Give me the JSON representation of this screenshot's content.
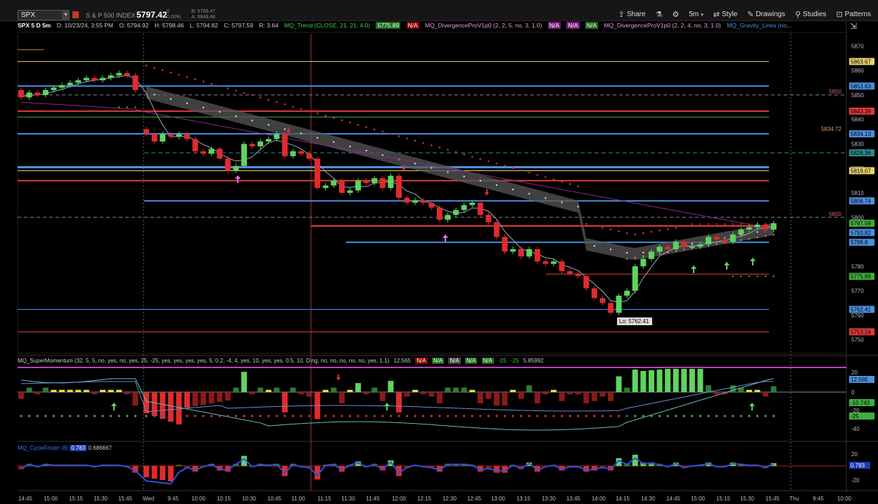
{
  "toolbar": {
    "symbol": "SPX",
    "description": "S & P 500 INDEX",
    "price": "5797.42",
    "change_line1": "0",
    "change_line2": "0.00%",
    "bid": "B: 5768.47",
    "ask": "A: 5848.48",
    "buttons": [
      {
        "icon": "share-icon",
        "label": "Share"
      },
      {
        "icon": "flask-icon",
        "label": ""
      },
      {
        "icon": "gear-icon",
        "label": ""
      },
      {
        "icon": "",
        "label": "5m"
      },
      {
        "icon": "style-icon",
        "label": "Style"
      },
      {
        "icon": "pencil-icon",
        "label": "Drawings"
      },
      {
        "icon": "studies-icon",
        "label": "Studies"
      },
      {
        "icon": "patterns-icon",
        "label": "Patterns"
      }
    ]
  },
  "info": {
    "symbol": "SPX 5 D 5m",
    "date": "D: 10/23/24, 3:55 PM",
    "open": "O: 5794.92",
    "high": "H: 5798.46",
    "low": "L: 5794.82",
    "close": "C: 5797.59",
    "range": "R: 3.64",
    "trend": "MQ_Trend (CLOSE, 21, 21, 4.0)",
    "trend_value": "5775.89",
    "na": "N/A",
    "div1": "MQ_DivergenceProV1p0 (2, 2, 5, no, 3, 1.0)",
    "div2": "MQ_DivergenceProV1p0 (2, 2, 4, no, 3, 1.0)",
    "gravity": "MQ_Gravity_Lines (no..."
  },
  "indicator": {
    "name": "MQ_SuperMomentum (32, 5, 5, no, yes, no, yes, 25, -25, yes, yes, yes, yes, 5, 0.2, -4, 4, yes, 10, yes, yes, 0.5, 10, Ding, no, no, no, no, no, yes, 1.1)",
    "v1": "12.565",
    "na": "N/A",
    "v2": "-25",
    "v3": "-25",
    "v4": "5.85992"
  },
  "cycle": {
    "name": "MQ_CycleFinder (8)",
    "v1": "0.783",
    "v2": "0.686667"
  },
  "price_axis": {
    "ticks": [
      5870,
      5860,
      5850,
      5840,
      5830,
      5820,
      5810,
      5800,
      5790,
      5780,
      5770,
      5760,
      5750
    ],
    "tags": [
      {
        "value": "5863.67",
        "color": "#e8d36a"
      },
      {
        "value": "5853.63",
        "color": "#4a90e2"
      },
      {
        "value": "5843.39",
        "color": "#e03a3a"
      },
      {
        "value": "5834.13",
        "color": "#4a90e2"
      },
      {
        "value": "5826.36",
        "color": "#2e8b8b"
      },
      {
        "value": "5819.07",
        "color": "#e8d36a"
      },
      {
        "value": "5806.74",
        "color": "#4a90e2"
      },
      {
        "value": "5797.59",
        "color": "#3fae3f"
      },
      {
        "value": "5793.82",
        "color": "#4a90e2"
      },
      {
        "value": "5789.8",
        "color": "#4a90e2"
      },
      {
        "value": "5775.89",
        "color": "#3fae3f"
      },
      {
        "value": "5762.41",
        "color": "#4a90e2"
      },
      {
        "value": "5753.24",
        "color": "#e03a3a"
      }
    ],
    "labels": [
      {
        "text": "5850",
        "color": "#e06060"
      },
      {
        "text": "5834.72",
        "color": "#e8a060"
      },
      {
        "text": "5800",
        "color": "#e06060"
      }
    ],
    "low_label": "Lo: 5762.41"
  },
  "mom_axis": {
    "ticks": [
      "20",
      "0",
      "-20",
      "-40"
    ],
    "tags": [
      {
        "value": "12.565",
        "color": "#4a90e2"
      },
      {
        "value": "-10.743",
        "color": "#3fae3f"
      },
      {
        "value": "-25",
        "color": "#3fae3f"
      }
    ]
  },
  "cycle_axis": {
    "ticks": [
      "20",
      "0",
      "-20"
    ],
    "tag": "0.783"
  },
  "time_axis": [
    "14:45",
    "15:00",
    "15:15",
    "15:30",
    "15:45",
    "Wed",
    "9:45",
    "10:00",
    "10:15",
    "10:30",
    "10:45",
    "11:00",
    "11:15",
    "11:30",
    "11:45",
    "12:00",
    "12:15",
    "12:30",
    "12:45",
    "13:00",
    "13:15",
    "13:30",
    "13:45",
    "14:00",
    "14:15",
    "14:30",
    "14:45",
    "15:00",
    "15:15",
    "15:30",
    "15:45",
    "Thu",
    "9:45",
    "10:00"
  ],
  "chart_data": {
    "type": "candlestick",
    "symbol": "SPX",
    "ylim": [
      5745,
      5875
    ],
    "x": [
      "14:45",
      "14:50",
      "14:55",
      "15:00",
      "15:05",
      "15:10",
      "15:15",
      "15:20",
      "15:25",
      "15:30",
      "15:35",
      "15:40",
      "15:45",
      "15:50",
      "15:55",
      "9:30",
      "9:35",
      "9:40",
      "9:45",
      "9:50",
      "9:55",
      "10:00",
      "10:05",
      "10:10",
      "10:15",
      "10:20",
      "10:25",
      "10:30",
      "10:35",
      "10:40",
      "10:45",
      "10:50",
      "10:55",
      "11:00",
      "11:05",
      "11:10",
      "11:15",
      "11:20",
      "11:25",
      "11:30",
      "11:35",
      "11:40",
      "11:45",
      "11:50",
      "11:55",
      "12:00",
      "12:05",
      "12:10",
      "12:15",
      "12:20",
      "12:25",
      "12:30",
      "12:35",
      "12:40",
      "12:45",
      "12:50",
      "12:55",
      "13:00",
      "13:05",
      "13:10",
      "13:15",
      "13:20",
      "13:25",
      "13:30",
      "13:35",
      "13:40",
      "13:45",
      "13:50",
      "13:55",
      "14:00",
      "14:05",
      "14:10",
      "14:15",
      "14:20",
      "14:25",
      "14:30",
      "14:35",
      "14:40",
      "14:45",
      "14:50",
      "14:55",
      "15:00",
      "15:05",
      "15:10",
      "15:15",
      "15:20",
      "15:25",
      "15:30",
      "15:35",
      "15:40",
      "15:45",
      "15:50",
      "15:55"
    ],
    "open": [
      5852,
      5849,
      5851,
      5850,
      5852,
      5853,
      5854,
      5855,
      5856,
      5857,
      5856,
      5857,
      5858,
      5859,
      5858,
      5836,
      5834,
      5831,
      5834,
      5833,
      5834,
      5832,
      5827,
      5826,
      5828,
      5824,
      5819,
      5821,
      5830,
      5829,
      5831,
      5832,
      5834,
      5825,
      5827,
      5826,
      5824,
      5812,
      5813,
      5815,
      5810,
      5811,
      5815,
      5814,
      5816,
      5812,
      5817,
      5808,
      5806,
      5807,
      5806,
      5804,
      5799,
      5801,
      5803,
      5805,
      5806,
      5801,
      5798,
      5792,
      5786,
      5787,
      5784,
      5787,
      5782,
      5781,
      5782,
      5778,
      5777,
      5776,
      5771,
      5767,
      5765,
      5761,
      5768,
      5770,
      5780,
      5783,
      5786,
      5788,
      5787,
      5790,
      5788,
      5788,
      5789,
      5792,
      5791,
      5790,
      5793,
      5795,
      5796,
      5797,
      5795
    ],
    "close": [
      5849,
      5851,
      5850,
      5852,
      5853,
      5854,
      5855,
      5856,
      5857,
      5856,
      5857,
      5858,
      5859,
      5858,
      5852,
      5834,
      5831,
      5834,
      5833,
      5834,
      5832,
      5827,
      5826,
      5828,
      5824,
      5819,
      5821,
      5830,
      5829,
      5831,
      5832,
      5834,
      5825,
      5827,
      5826,
      5824,
      5812,
      5813,
      5815,
      5810,
      5811,
      5815,
      5814,
      5816,
      5812,
      5817,
      5808,
      5806,
      5807,
      5806,
      5804,
      5799,
      5801,
      5803,
      5805,
      5806,
      5801,
      5798,
      5792,
      5786,
      5787,
      5784,
      5787,
      5782,
      5781,
      5782,
      5778,
      5777,
      5776,
      5771,
      5767,
      5765,
      5761,
      5768,
      5770,
      5780,
      5783,
      5786,
      5788,
      5787,
      5790,
      5788,
      5788,
      5789,
      5792,
      5791,
      5790,
      5793,
      5795,
      5796,
      5797,
      5795,
      5797.59
    ]
  }
}
